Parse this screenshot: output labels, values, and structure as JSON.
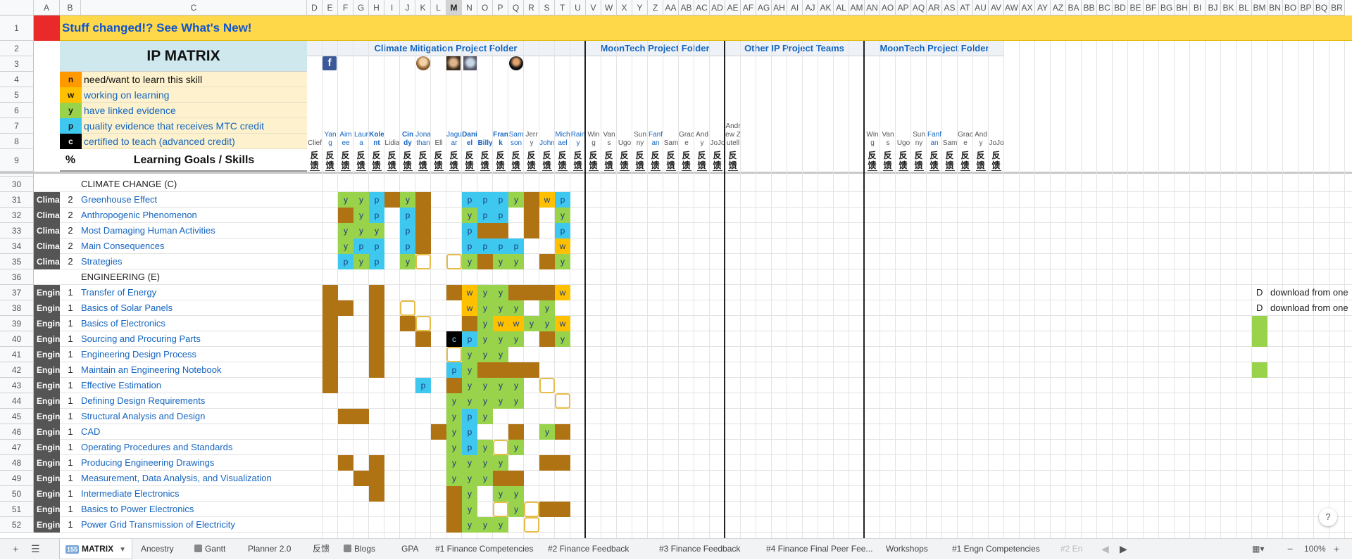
{
  "columns": [
    "A",
    "B",
    "C",
    "D",
    "E",
    "F",
    "G",
    "H",
    "I",
    "J",
    "K",
    "L",
    "M",
    "N",
    "O",
    "P",
    "Q",
    "R",
    "S",
    "T",
    "U",
    "V",
    "W",
    "X",
    "Y",
    "Z",
    "AA",
    "AB",
    "AC",
    "AD",
    "AE",
    "AF",
    "AG",
    "AH",
    "AI",
    "AJ",
    "AK",
    "AL",
    "AM",
    "AN",
    "AO",
    "AP",
    "AQ",
    "AR",
    "AS",
    "AT",
    "AU",
    "AV",
    "AW",
    "AX",
    "AY",
    "AZ",
    "BA",
    "BB",
    "BC",
    "BD",
    "BE",
    "BF",
    "BG",
    "BH",
    "BI",
    "BJ",
    "BK",
    "BL",
    "BM",
    "BN",
    "BO",
    "BP",
    "BQ",
    "BR"
  ],
  "selected_column": "M",
  "banner": "Stuff changed!? See What's New!",
  "ip_matrix_title": "IP MATRIX",
  "legend": [
    {
      "key": "n",
      "label": "need/want to learn this skill"
    },
    {
      "key": "w",
      "label": "working on learning"
    },
    {
      "key": "y",
      "label": "have linked evidence"
    },
    {
      "key": "p",
      "label": "quality evidence that receives MTC credit"
    },
    {
      "key": "c",
      "label": "certified to teach (advanced credit)"
    }
  ],
  "header9": {
    "percent": "%",
    "goals": "Learning Goals / Skills"
  },
  "folders": [
    "Climate Mitigation Project Folder",
    "MoonTech Project Folder",
    "Other IP Project Teams",
    "MoonTech Project Folder"
  ],
  "group1_names": [
    "Clief",
    "Yang",
    "Aimee",
    "Laura",
    "Kolent",
    "Lidia",
    "Cindy",
    "Jonathan",
    "Ell",
    "Jaguar",
    "Daniel",
    "Billy",
    "Frank",
    "Samson",
    "Jerry",
    "John",
    "Michael",
    "Rainy"
  ],
  "group2_names": [
    "Wing",
    "Vans",
    "Ugo",
    "Sunny",
    "Fanfan",
    "Sam",
    "Grace",
    "Andy",
    "JoJo"
  ],
  "group3_names": [
    "Andrew Zutell"
  ],
  "group4_names": [
    "Wing",
    "Vans",
    "Ugo",
    "Sunny",
    "Fanfan",
    "Sam",
    "Grace",
    "Andy",
    "JoJo"
  ],
  "feedback_label": "反馈",
  "section_climate": {
    "row": "30",
    "label": "CLIMATE CHANGE (C)"
  },
  "section_eng": {
    "row": "36",
    "label": "ENGINEERING (E)"
  },
  "climate_rows": [
    {
      "row": "31",
      "a": "Clima",
      "b": "2",
      "skill": "Greenhouse Effect"
    },
    {
      "row": "32",
      "a": "Clima",
      "b": "2",
      "skill": "Anthropogenic Phenomenon"
    },
    {
      "row": "33",
      "a": "Clima",
      "b": "2",
      "skill": "Most Damaging Human Activities"
    },
    {
      "row": "34",
      "a": "Clima",
      "b": "2",
      "skill": "Main Consequences"
    },
    {
      "row": "35",
      "a": "Clima",
      "b": "2",
      "skill": "Strategies"
    }
  ],
  "eng_rows": [
    {
      "row": "37",
      "a": "Engin",
      "b": "1",
      "skill": "Transfer of Energy"
    },
    {
      "row": "38",
      "a": "Engin",
      "b": "1",
      "skill": "Basics of Solar Panels"
    },
    {
      "row": "39",
      "a": "Engin",
      "b": "1",
      "skill": "Basics of Electronics"
    },
    {
      "row": "40",
      "a": "Engin",
      "b": "1",
      "skill": "Sourcing and Procuring Parts"
    },
    {
      "row": "41",
      "a": "Engin",
      "b": "1",
      "skill": "Engineering Design Process"
    },
    {
      "row": "42",
      "a": "Engin",
      "b": "1",
      "skill": "Maintain an Engineering Notebook"
    },
    {
      "row": "43",
      "a": "Engin",
      "b": "1",
      "skill": "Effective Estimation"
    },
    {
      "row": "44",
      "a": "Engin",
      "b": "1",
      "skill": "Defining Design Requirements"
    },
    {
      "row": "45",
      "a": "Engin",
      "b": "1",
      "skill": "Structural Analysis and Design"
    },
    {
      "row": "46",
      "a": "Engin",
      "b": "1",
      "skill": "CAD"
    },
    {
      "row": "47",
      "a": "Engin",
      "b": "1",
      "skill": "Operating Procedures and Standards"
    },
    {
      "row": "48",
      "a": "Engin",
      "b": "1",
      "skill": "Producing Engineering Drawings"
    },
    {
      "row": "49",
      "a": "Engin",
      "b": "1",
      "skill": "Measurement, Data Analysis, and Visualization"
    },
    {
      "row": "50",
      "a": "Engin",
      "b": "1",
      "skill": "Intermediate Electronics"
    },
    {
      "row": "51",
      "a": "Engin",
      "b": "1",
      "skill": "Basics to Power Electronics"
    },
    {
      "row": "52",
      "a": "Engin",
      "b": "1",
      "skill": "Power Grid Transmission of Electricity"
    }
  ],
  "matrix": {
    "31": [
      "",
      "",
      "y",
      "y",
      "p",
      "b",
      "y",
      "b",
      "",
      "",
      "p",
      "p",
      "p",
      "y",
      "b",
      "w",
      "p",
      ""
    ],
    "32": [
      "",
      "",
      "b",
      "y",
      "p",
      "",
      "p",
      "b",
      "",
      "",
      "y",
      "p",
      "p",
      "",
      "b",
      "",
      "y",
      ""
    ],
    "33": [
      "",
      "",
      "y",
      "y",
      "y",
      "",
      "p",
      "b",
      "",
      "",
      "p",
      "b",
      "b",
      "",
      "b",
      "",
      "p",
      ""
    ],
    "34": [
      "",
      "",
      "y",
      "p",
      "p",
      "",
      "p",
      "b",
      "",
      "",
      "p",
      "p",
      "p",
      "p",
      "",
      "",
      "w",
      ""
    ],
    "35": [
      "",
      "",
      "p",
      "y",
      "p",
      "",
      "y",
      "o",
      "",
      "o",
      "y",
      "b",
      "y",
      "y",
      "",
      "b",
      "y",
      ""
    ],
    "37": [
      "",
      "b",
      "",
      "",
      "b",
      "",
      "",
      "",
      "",
      "b",
      "w",
      "y",
      "y",
      "b",
      "b",
      "b",
      "w",
      ""
    ],
    "38": [
      "",
      "b",
      "b",
      "",
      "b",
      "",
      "o",
      "",
      "",
      "",
      "w",
      "y",
      "y",
      "y",
      "",
      "y",
      "",
      ""
    ],
    "39": [
      "",
      "b",
      "",
      "",
      "b",
      "",
      "b",
      "o",
      "",
      "",
      "b",
      "y",
      "w",
      "w",
      "y",
      "y",
      "w",
      ""
    ],
    "40": [
      "",
      "b",
      "",
      "",
      "b",
      "",
      "",
      "b",
      "",
      "c",
      "p",
      "y",
      "y",
      "y",
      "",
      "b",
      "y",
      ""
    ],
    "41": [
      "",
      "b",
      "",
      "",
      "b",
      "",
      "",
      "",
      "",
      "o",
      "y",
      "y",
      "y",
      "",
      "",
      "",
      "",
      ""
    ],
    "42": [
      "",
      "b",
      "",
      "",
      "b",
      "",
      "",
      "",
      "",
      "p",
      "y",
      "b",
      "b",
      "b",
      "b",
      "",
      "",
      ""
    ],
    "43": [
      "",
      "b",
      "",
      "",
      "",
      "",
      "",
      "p",
      "",
      "b",
      "y",
      "y",
      "y",
      "y",
      "",
      "o",
      "",
      ""
    ],
    "44": [
      "",
      "",
      "",
      "",
      "",
      "",
      "",
      "",
      "",
      "y",
      "y",
      "y",
      "y",
      "y",
      "",
      "",
      "o",
      ""
    ],
    "45": [
      "",
      "",
      "b",
      "b",
      "",
      "",
      "",
      "",
      "",
      "y",
      "p",
      "y",
      "",
      "",
      "",
      "",
      "",
      ""
    ],
    "46": [
      "",
      "",
      "",
      "",
      "",
      "",
      "",
      "",
      "b",
      "y",
      "p",
      "",
      "",
      "b",
      "",
      "y",
      "b",
      ""
    ],
    "47": [
      "",
      "",
      "",
      "",
      "",
      "",
      "",
      "",
      "",
      "y",
      "p",
      "y",
      "o",
      "y",
      "",
      "",
      "",
      ""
    ],
    "48": [
      "",
      "",
      "b",
      "",
      "b",
      "",
      "",
      "",
      "",
      "y",
      "y",
      "y",
      "y",
      "",
      "",
      "b",
      "b",
      ""
    ],
    "49": [
      "",
      "",
      "",
      "b",
      "b",
      "",
      "",
      "",
      "",
      "y",
      "y",
      "y",
      "b",
      "b",
      "",
      "",
      "",
      ""
    ],
    "50": [
      "",
      "",
      "",
      "",
      "b",
      "",
      "",
      "",
      "",
      "b",
      "y",
      "",
      "y",
      "y",
      "",
      "",
      "",
      ""
    ],
    "51": [
      "",
      "",
      "",
      "",
      "",
      "",
      "",
      "",
      "",
      "b",
      "y",
      "",
      "o",
      "y",
      "o",
      "b",
      "b",
      ""
    ],
    "52": [
      "",
      "",
      "",
      "",
      "",
      "",
      "",
      "",
      "",
      "b",
      "y",
      "y",
      "y",
      "",
      "o",
      "",
      "",
      ""
    ]
  },
  "side_notes": [
    {
      "row": "37",
      "col": "BM",
      "text": "D",
      "note": "download from one"
    },
    {
      "row": "38",
      "col": "BM",
      "text": "D",
      "note": "download from one"
    }
  ],
  "sheet_tabs": [
    {
      "label": "MATRIX",
      "badge": "155",
      "active": true
    },
    {
      "label": "Ancestry"
    },
    {
      "label": "Gantt"
    },
    {
      "label": "Planner 2.0"
    },
    {
      "label": "反馈"
    },
    {
      "label": "Blogs"
    },
    {
      "label": "GPA"
    },
    {
      "label": "#1 Finance Competencies"
    },
    {
      "label": "#2 Finance Feedback"
    },
    {
      "label": "#3 Finance Feedback"
    },
    {
      "label": "#4 Finance Final Peer Fee..."
    },
    {
      "label": "Workshops"
    },
    {
      "label": "#1 Engn Competencies"
    },
    {
      "label": "#2 En"
    }
  ],
  "zoom": "100%",
  "colors": {
    "brown": "#b07314",
    "green": "#99d24b",
    "blue": "#3ec8f0",
    "yellow": "#ffc000",
    "orange": "#ff9900"
  }
}
